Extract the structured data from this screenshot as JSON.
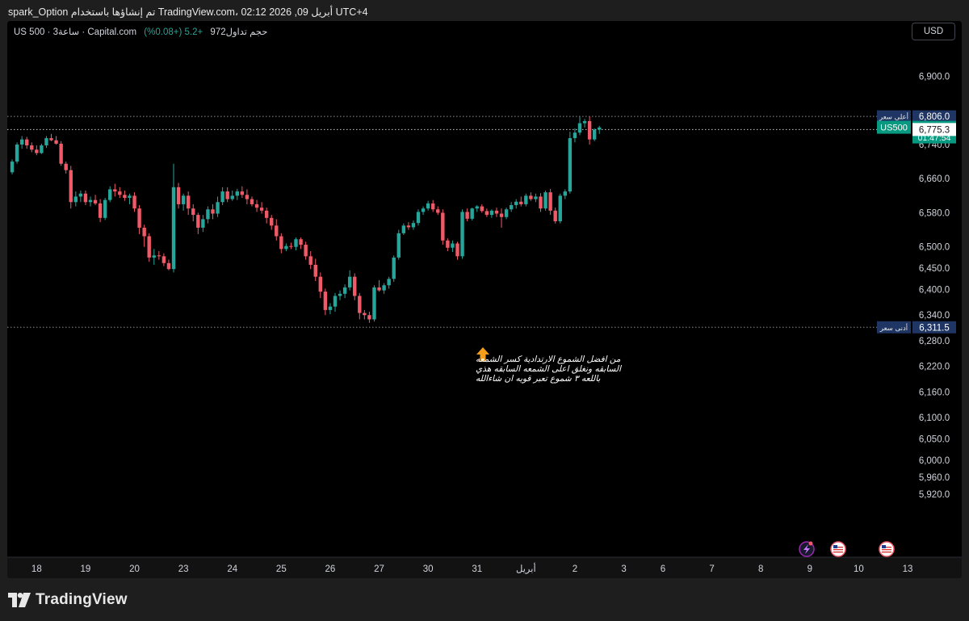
{
  "caption": "spark_Option تم إنشاؤها باستخدام TradingView.com، 02:12 2026 ,09 أبريل UTC+4",
  "header": {
    "symbol": "US 500 · 3ساعة · Capital.com",
    "volume": "حجم تداول972",
    "change": "+5.2 (+0.08%)",
    "currency_button": "USD"
  },
  "colors": {
    "up": "#26a69a",
    "down": "#f05a68",
    "background": "#000000",
    "high_low_label": "#1f3563",
    "price_label": "#089981",
    "arrow": "#f59c1a"
  },
  "price_labels": {
    "high_caption": "أعلى سعر",
    "high_value": "6,806.0",
    "symbol_tag": "US500",
    "last_price": "6,780.5",
    "countdown": "01:47:54",
    "crosshair_price": "6,775.3",
    "low_caption": "أدنى سعر",
    "low_value": "6,311.5"
  },
  "annotation": {
    "text_line1": "من افضل الشموع الارتدادية كسر الشمعه",
    "text_line2": "السابقه ونغلق اعلى الشمعه السابقه هذي",
    "text_line3": "باللعه ٣ شموع تعبر قويه ان شاءالله"
  },
  "footer": {
    "brand": "TradingView"
  },
  "event_icons": [
    "lightning-icon",
    "us-flag-icon",
    "us-flag-icon"
  ],
  "chart_data": {
    "type": "candlestick",
    "y_axis": {
      "min": 5900,
      "max": 6960,
      "ticks": [
        5920,
        5960,
        6000,
        6050,
        6100,
        6160,
        6220,
        6280,
        6340,
        6400,
        6450,
        6500,
        6580,
        6660,
        6740,
        6900
      ],
      "tick_labels": [
        "5,920.0",
        "5,960.0",
        "6,000.0",
        "6,050.0",
        "6,100.0",
        "6,160.0",
        "6,220.0",
        "6,280.0",
        "6,340.0",
        "6,400.0",
        "6,450.0",
        "6,500.0",
        "6,580.0",
        "6,660.0",
        "6,740.0",
        "6,900.0"
      ]
    },
    "x_axis": {
      "labels": [
        "18",
        "19",
        "20",
        "23",
        "24",
        "25",
        "26",
        "27",
        "30",
        "31",
        "أبريل",
        "2",
        "3",
        "6",
        "7",
        "8",
        "9",
        "10",
        "13"
      ],
      "label_bar_index": [
        5,
        15,
        25,
        35,
        45,
        55,
        65,
        75,
        85,
        95,
        105,
        115,
        125,
        133,
        143,
        153,
        163,
        173,
        183
      ]
    },
    "high": 6806.0,
    "low": 6311.5,
    "last": 6780.5,
    "crosshair": 6775.3,
    "candles": [
      [
        6675,
        6705,
        6670,
        6700
      ],
      [
        6700,
        6745,
        6695,
        6740
      ],
      [
        6740,
        6760,
        6730,
        6752
      ],
      [
        6752,
        6758,
        6730,
        6738
      ],
      [
        6738,
        6745,
        6722,
        6728
      ],
      [
        6728,
        6738,
        6715,
        6720
      ],
      [
        6720,
        6742,
        6718,
        6738
      ],
      [
        6738,
        6760,
        6732,
        6755
      ],
      [
        6755,
        6765,
        6748,
        6750
      ],
      [
        6750,
        6760,
        6740,
        6742
      ],
      [
        6742,
        6748,
        6690,
        6695
      ],
      [
        6695,
        6700,
        6672,
        6680
      ],
      [
        6680,
        6690,
        6590,
        6605
      ],
      [
        6605,
        6630,
        6595,
        6618
      ],
      [
        6618,
        6632,
        6605,
        6625
      ],
      [
        6625,
        6632,
        6598,
        6605
      ],
      [
        6605,
        6618,
        6595,
        6610
      ],
      [
        6610,
        6622,
        6598,
        6602
      ],
      [
        6602,
        6612,
        6558,
        6568
      ],
      [
        6568,
        6615,
        6563,
        6610
      ],
      [
        6610,
        6642,
        6605,
        6635
      ],
      [
        6635,
        6648,
        6618,
        6630
      ],
      [
        6630,
        6640,
        6615,
        6622
      ],
      [
        6622,
        6632,
        6608,
        6615
      ],
      [
        6615,
        6625,
        6600,
        6620
      ],
      [
        6620,
        6628,
        6582,
        6590
      ],
      [
        6590,
        6598,
        6530,
        6545
      ],
      [
        6545,
        6552,
        6500,
        6525
      ],
      [
        6525,
        6532,
        6465,
        6475
      ],
      [
        6475,
        6495,
        6458,
        6480
      ],
      [
        6480,
        6490,
        6470,
        6478
      ],
      [
        6478,
        6485,
        6455,
        6462
      ],
      [
        6462,
        6470,
        6445,
        6448
      ],
      [
        6448,
        6695,
        6440,
        6640
      ],
      [
        6640,
        6650,
        6590,
        6600
      ],
      [
        6600,
        6625,
        6585,
        6620
      ],
      [
        6620,
        6630,
        6575,
        6590
      ],
      [
        6590,
        6600,
        6560,
        6575
      ],
      [
        6575,
        6580,
        6530,
        6545
      ],
      [
        6545,
        6575,
        6535,
        6565
      ],
      [
        6565,
        6595,
        6555,
        6588
      ],
      [
        6588,
        6600,
        6565,
        6578
      ],
      [
        6578,
        6618,
        6570,
        6605
      ],
      [
        6605,
        6640,
        6598,
        6630
      ],
      [
        6630,
        6640,
        6605,
        6612
      ],
      [
        6612,
        6632,
        6608,
        6620
      ],
      [
        6620,
        6636,
        6610,
        6630
      ],
      [
        6630,
        6642,
        6615,
        6622
      ],
      [
        6622,
        6635,
        6600,
        6612
      ],
      [
        6612,
        6618,
        6595,
        6600
      ],
      [
        6600,
        6610,
        6582,
        6592
      ],
      [
        6592,
        6605,
        6578,
        6585
      ],
      [
        6585,
        6592,
        6555,
        6568
      ],
      [
        6568,
        6575,
        6540,
        6550
      ],
      [
        6550,
        6565,
        6515,
        6525
      ],
      [
        6525,
        6532,
        6485,
        6495
      ],
      [
        6495,
        6508,
        6490,
        6502
      ],
      [
        6502,
        6510,
        6495,
        6500
      ],
      [
        6500,
        6522,
        6492,
        6518
      ],
      [
        6518,
        6522,
        6495,
        6505
      ],
      [
        6505,
        6512,
        6470,
        6478
      ],
      [
        6478,
        6490,
        6448,
        6458
      ],
      [
        6458,
        6472,
        6420,
        6430
      ],
      [
        6430,
        6440,
        6380,
        6395
      ],
      [
        6395,
        6402,
        6340,
        6352
      ],
      [
        6352,
        6368,
        6342,
        6360
      ],
      [
        6360,
        6392,
        6348,
        6385
      ],
      [
        6385,
        6398,
        6375,
        6390
      ],
      [
        6390,
        6412,
        6380,
        6405
      ],
      [
        6405,
        6445,
        6398,
        6430
      ],
      [
        6430,
        6438,
        6375,
        6385
      ],
      [
        6385,
        6392,
        6330,
        6345
      ],
      [
        6345,
        6352,
        6330,
        6340
      ],
      [
        6340,
        6348,
        6322,
        6330
      ],
      [
        6330,
        6410,
        6325,
        6405
      ],
      [
        6405,
        6422,
        6395,
        6398
      ],
      [
        6398,
        6415,
        6390,
        6410
      ],
      [
        6410,
        6430,
        6402,
        6425
      ],
      [
        6425,
        6480,
        6418,
        6475
      ],
      [
        6475,
        6540,
        6470,
        6532
      ],
      [
        6532,
        6555,
        6528,
        6550
      ],
      [
        6550,
        6558,
        6540,
        6546
      ],
      [
        6546,
        6562,
        6540,
        6556
      ],
      [
        6556,
        6588,
        6550,
        6582
      ],
      [
        6582,
        6595,
        6575,
        6590
      ],
      [
        6590,
        6608,
        6585,
        6602
      ],
      [
        6602,
        6610,
        6582,
        6588
      ],
      [
        6588,
        6595,
        6575,
        6580
      ],
      [
        6580,
        6588,
        6505,
        6515
      ],
      [
        6515,
        6520,
        6490,
        6498
      ],
      [
        6498,
        6515,
        6488,
        6508
      ],
      [
        6508,
        6512,
        6470,
        6478
      ],
      [
        6478,
        6588,
        6472,
        6582
      ],
      [
        6582,
        6590,
        6560,
        6566
      ],
      [
        6566,
        6592,
        6562,
        6590
      ],
      [
        6590,
        6598,
        6582,
        6595
      ],
      [
        6595,
        6600,
        6580,
        6584
      ],
      [
        6584,
        6590,
        6570,
        6575
      ],
      [
        6575,
        6588,
        6568,
        6585
      ],
      [
        6585,
        6592,
        6570,
        6578
      ],
      [
        6578,
        6590,
        6545,
        6570
      ],
      [
        6570,
        6592,
        6565,
        6588
      ],
      [
        6588,
        6605,
        6582,
        6598
      ],
      [
        6598,
        6612,
        6590,
        6606
      ],
      [
        6606,
        6618,
        6595,
        6600
      ],
      [
        6600,
        6625,
        6595,
        6620
      ],
      [
        6620,
        6628,
        6608,
        6612
      ],
      [
        6612,
        6625,
        6605,
        6618
      ],
      [
        6618,
        6626,
        6582,
        6590
      ],
      [
        6590,
        6632,
        6585,
        6628
      ],
      [
        6628,
        6636,
        6575,
        6585
      ],
      [
        6585,
        6592,
        6555,
        6560
      ],
      [
        6560,
        6625,
        6555,
        6620
      ],
      [
        6620,
        6635,
        6612,
        6630
      ],
      [
        6630,
        6770,
        6625,
        6755
      ],
      [
        6755,
        6778,
        6745,
        6768
      ],
      [
        6768,
        6805,
        6762,
        6790
      ],
      [
        6790,
        6800,
        6780,
        6795
      ],
      [
        6795,
        6806,
        6740,
        6752
      ],
      [
        6752,
        6778,
        6748,
        6775
      ],
      [
        6775,
        6784,
        6765,
        6780
      ]
    ]
  }
}
